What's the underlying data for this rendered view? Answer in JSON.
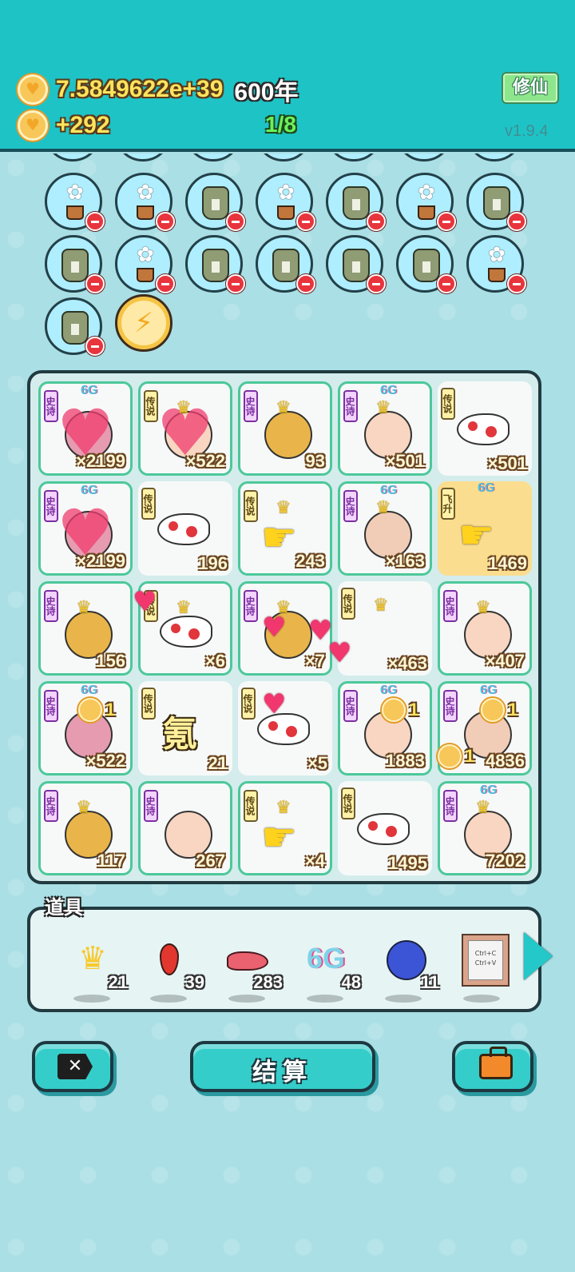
{
  "header": {
    "coins_total": "7.5849622e+39",
    "years": "600年",
    "coins_rate": "+292",
    "progress": "1/8",
    "xiuxian_label": "修仙",
    "version": "v1.9.4"
  },
  "inventory_icons": [
    "flower-pot",
    "flower-pot",
    "sack",
    "flower-pot",
    "sack",
    "flower-pot",
    "sack",
    "sack",
    "flower-pot",
    "sack",
    "sack",
    "sack",
    "sack",
    "flower-pot",
    "sack"
  ],
  "grid": {
    "cells": [
      {
        "tag": "史诗",
        "badge": "6G",
        "sprite": "girl-heart",
        "count": "×2199"
      },
      {
        "tag": "传说",
        "badge": "",
        "sprite": "heart-crown",
        "count": "×522"
      },
      {
        "tag": "史诗",
        "badge": "",
        "sprite": "bird-crown",
        "count": "93"
      },
      {
        "tag": "史诗",
        "badge": "6G",
        "sprite": "bald-crown",
        "count": "×501"
      },
      {
        "tag": "传说",
        "badge": "",
        "sprite": "fish",
        "count": "×501"
      },
      {
        "tag": "史诗",
        "badge": "6G",
        "sprite": "girl-heart",
        "count": "×2199"
      },
      {
        "tag": "传说",
        "badge": "",
        "sprite": "fish",
        "count": "196"
      },
      {
        "tag": "传说",
        "badge": "",
        "sprite": "hand-crown",
        "count": "243"
      },
      {
        "tag": "史诗",
        "badge": "6G",
        "sprite": "glasses-crown",
        "count": "×163"
      },
      {
        "tag": "飞升",
        "badge": "6G",
        "sprite": "hand",
        "count": "1469"
      },
      {
        "tag": "史诗",
        "badge": "",
        "sprite": "bird-crown",
        "count": "156"
      },
      {
        "tag": "传说",
        "badge": "",
        "sprite": "fish-crown",
        "count": "×6"
      },
      {
        "tag": "史诗",
        "badge": "",
        "sprite": "bird-crown",
        "count": "×7"
      },
      {
        "tag": "传说",
        "badge": "",
        "sprite": "crown",
        "count": "×463"
      },
      {
        "tag": "史诗",
        "badge": "",
        "sprite": "bald-crown",
        "count": "×407"
      },
      {
        "tag": "史诗",
        "badge": "6G",
        "sprite": "girl",
        "count": "×522"
      },
      {
        "tag": "传说",
        "badge": "",
        "sprite": "hanzi",
        "hanzi": "氪",
        "count": "21"
      },
      {
        "tag": "传说",
        "badge": "",
        "sprite": "fish",
        "count": "×5"
      },
      {
        "tag": "史诗",
        "badge": "6G",
        "sprite": "bald",
        "count": "1883"
      },
      {
        "tag": "史诗",
        "badge": "6G",
        "sprite": "glasses",
        "count": "4836"
      },
      {
        "tag": "史诗",
        "badge": "",
        "sprite": "bird-crown",
        "count": "117"
      },
      {
        "tag": "史诗",
        "badge": "",
        "sprite": "bald",
        "count": "267"
      },
      {
        "tag": "传说",
        "badge": "",
        "sprite": "hand-crown",
        "count": "×4"
      },
      {
        "tag": "传说",
        "badge": "",
        "sprite": "fish",
        "count": "1495"
      },
      {
        "tag": "史诗",
        "badge": "6G",
        "sprite": "bald-crown",
        "count": "7202"
      }
    ],
    "coin_popups": [
      "1",
      "1",
      "1",
      "1"
    ]
  },
  "props": {
    "title": "道具",
    "items": [
      {
        "icon": "crown-icon",
        "count": "21"
      },
      {
        "icon": "pepper-icon",
        "count": "39"
      },
      {
        "icon": "liver-icon",
        "count": "283"
      },
      {
        "icon": "6g-icon",
        "label": "6G",
        "count": "48"
      },
      {
        "icon": "blueberry-icon",
        "count": "11"
      },
      {
        "icon": "ctrl-cv-icon",
        "label_top": "Ctrl+C",
        "label_bottom": "Ctrl+V",
        "count": ""
      }
    ]
  },
  "buttons": {
    "settle_label": "结算"
  }
}
